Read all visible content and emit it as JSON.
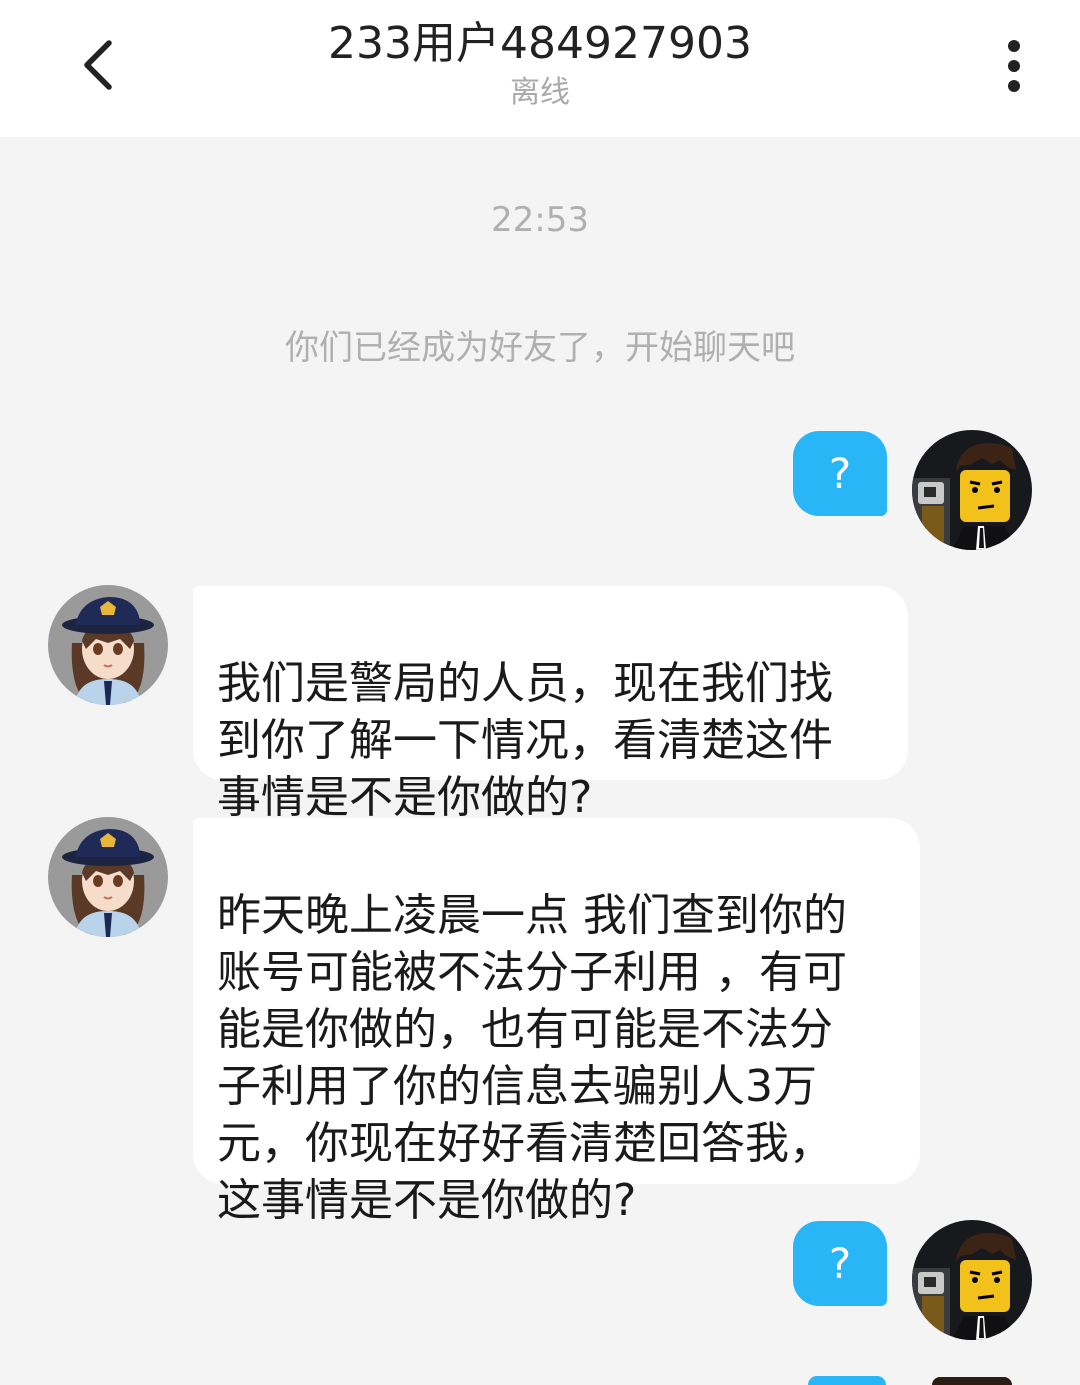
{
  "header": {
    "title": "233用户484927903",
    "status": "离线",
    "back_icon": "chevron-left-icon",
    "more_icon": "more-vertical-icon"
  },
  "chat": {
    "timestamp": "22:53",
    "system_message": "你们已经成为好友了，开始聊天吧",
    "messages": [
      {
        "side": "out",
        "text": "?"
      },
      {
        "side": "in",
        "text": "我们是警局的人员，现在我们找\n到你了解一下情况，看清楚这件\n事情是不是你做的?"
      },
      {
        "side": "in",
        "text": "昨天晚上凌晨一点 我们查到你的\n账号可能被不法分子利用 ，有可\n能是你做的，也有可能是不法分\n子利用了你的信息去骗别人3万\n元，你现在好好看清楚回答我，\n这事情是不是你做的?"
      },
      {
        "side": "out",
        "text": "?"
      }
    ]
  },
  "colors": {
    "out_bubble": "#29b6f6",
    "in_bubble": "#ffffff",
    "background": "#f4f4f4"
  }
}
